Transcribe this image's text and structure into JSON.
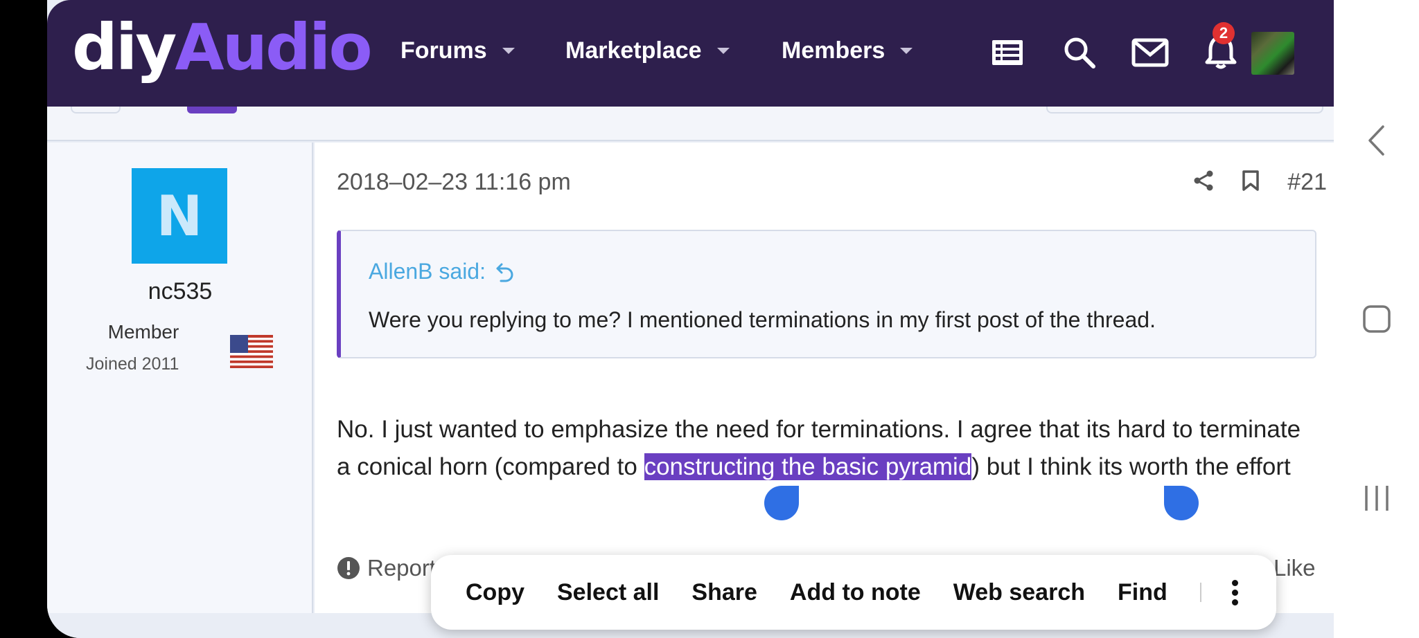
{
  "nav": {
    "logo_part1": "diy",
    "logo_part2": "Audio",
    "forums": "Forums",
    "marketplace": "Marketplace",
    "members": "Members",
    "notification_count": "2",
    "icons": [
      "list-icon",
      "search-icon",
      "mail-icon",
      "bell-icon"
    ]
  },
  "user": {
    "avatar_letter": "N",
    "name": "nc535",
    "role": "Member",
    "joined": "Joined 2011",
    "flag": "us-flag"
  },
  "post": {
    "timestamp": "2018–02–23 11:16 pm",
    "number": "#21",
    "quote_author": "AllenB said:",
    "quote_text": "Were you replying to me? I mentioned terminations in my first post of the thread.",
    "body_before": "No. I just wanted to emphasize the need for terminations. I agree that its hard to terminate a conical horn (compared to ",
    "body_selected": "constructing the basic pyramid",
    "body_after": ") but I think its worth the effort",
    "report_label": "Report",
    "like_label": "Like"
  },
  "context_menu": {
    "items": [
      "Copy",
      "Select all",
      "Share",
      "Add to note",
      "Web search",
      "Find"
    ]
  },
  "colors": {
    "navbar": "#2e1f4d",
    "accent": "#8b5cf6",
    "selection": "#6a3fc1",
    "handle": "#2f6fe4",
    "avatar": "#0ea5e9",
    "quote_author": "#4aa8e0",
    "badge": "#e03131"
  }
}
